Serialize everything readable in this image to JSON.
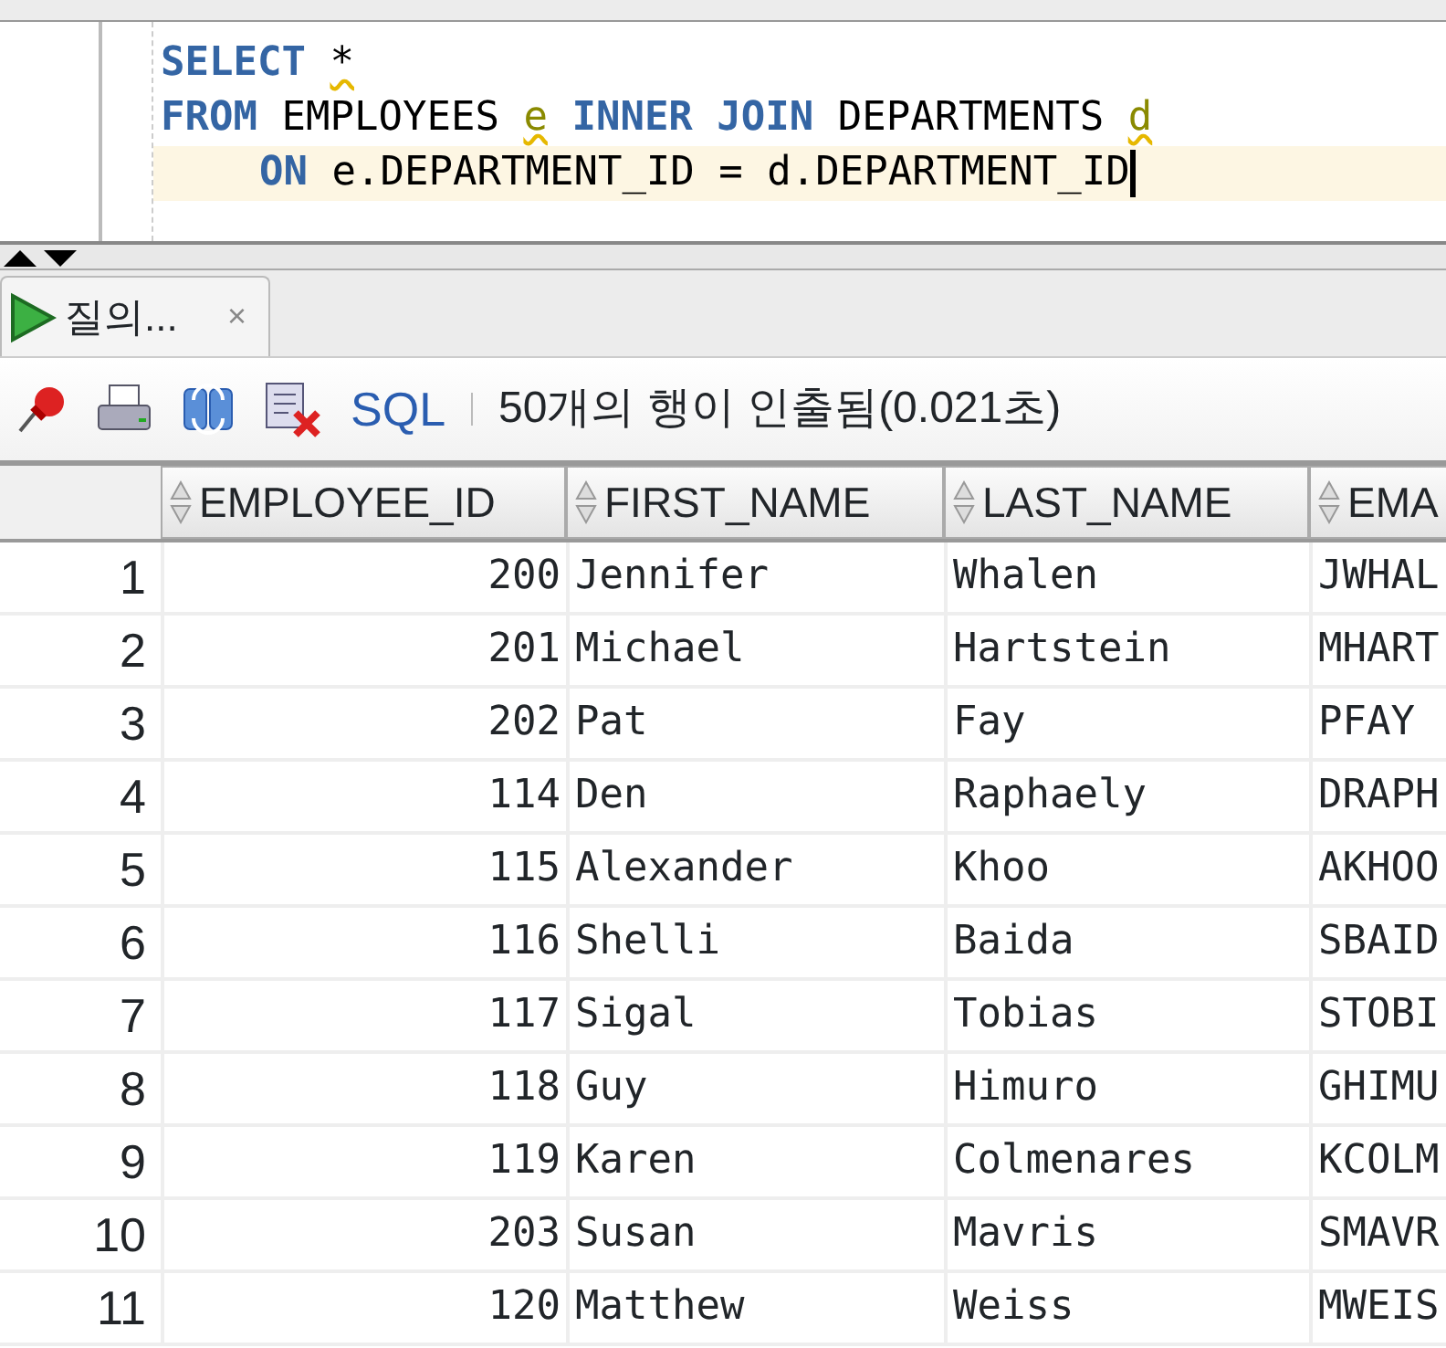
{
  "editor": {
    "lines": [
      {
        "current": false,
        "indented": false,
        "tokens": [
          {
            "kind": "keyword",
            "text": "SELECT"
          },
          {
            "kind": "warn",
            "text": "*"
          }
        ]
      },
      {
        "current": false,
        "indented": false,
        "tokens": [
          {
            "kind": "keyword",
            "text": "FROM"
          },
          {
            "kind": "plain",
            "text": "EMPLOYEES"
          },
          {
            "kind": "alias",
            "text": "e"
          },
          {
            "kind": "keyword",
            "text": "INNER JOIN"
          },
          {
            "kind": "plain",
            "text": "DEPARTMENTS"
          },
          {
            "kind": "alias",
            "text": "d"
          }
        ]
      },
      {
        "current": true,
        "indented": true,
        "tokens": [
          {
            "kind": "keyword",
            "text": "ON"
          },
          {
            "kind": "plain",
            "text": "e.DEPARTMENT_ID = d.DEPARTMENT_ID"
          }
        ]
      }
    ]
  },
  "results_tab": {
    "label": "질의...",
    "close": "×",
    "selected": true
  },
  "toolbar": {
    "sql_label": "SQL",
    "status": "50개의 행이 인출됨(0.021초)"
  },
  "table": {
    "columns": [
      "",
      "EMPLOYEE_ID",
      "FIRST_NAME",
      "LAST_NAME",
      "EMA"
    ],
    "rows": [
      [
        "1",
        "200",
        "Jennifer",
        "Whalen",
        "JWHAL"
      ],
      [
        "2",
        "201",
        "Michael",
        "Hartstein",
        "MHART"
      ],
      [
        "3",
        "202",
        "Pat",
        "Fay",
        "PFAY"
      ],
      [
        "4",
        "114",
        "Den",
        "Raphaely",
        "DRAPH"
      ],
      [
        "5",
        "115",
        "Alexander",
        "Khoo",
        "AKHOO"
      ],
      [
        "6",
        "116",
        "Shelli",
        "Baida",
        "SBAID"
      ],
      [
        "7",
        "117",
        "Sigal",
        "Tobias",
        "STOBI"
      ],
      [
        "8",
        "118",
        "Guy",
        "Himuro",
        "GHIMU"
      ],
      [
        "9",
        "119",
        "Karen",
        "Colmenares",
        "KCOLM"
      ],
      [
        "10",
        "203",
        "Susan",
        "Mavris",
        "SMAVR"
      ],
      [
        "11",
        "120",
        "Matthew",
        "Weiss",
        "MWEIS"
      ]
    ]
  }
}
